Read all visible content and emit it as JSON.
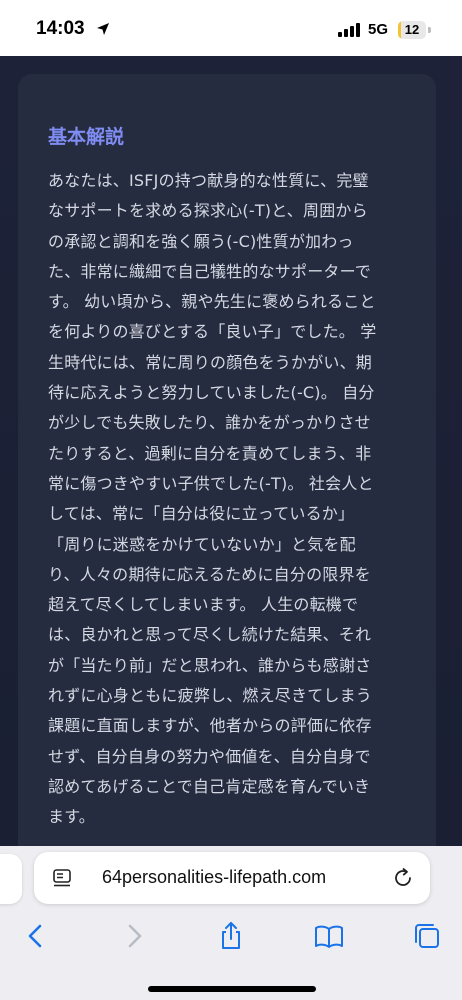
{
  "status_bar": {
    "time": "14:03",
    "network": "5G",
    "battery_level": "12",
    "battery_fraction": 0.12,
    "icons": [
      "location-arrow-icon",
      "cellular-signal-icon",
      "battery-icon"
    ]
  },
  "article": {
    "heading": "基本解説",
    "body": "あなたは、ISFJの持つ献身的な性質に、完璧\nなサポートを求める探求心(-T)と、周囲から\nの承認と調和を強く願う(-C)性質が加わっ\nた、非常に繊細で自己犠牲的なサポーターで\nす。 幼い頃から、親や先生に褒められること\nを何よりの喜びとする「良い子」でした。 学\n生時代には、常に周りの顔色をうかがい、期\n待に応えようと努力していました(-C)。 自分\nが少しでも失敗したり、誰かをがっかりさせ\nたりすると、過剰に自分を責めてしまう、非\n常に傷つきやすい子供でした(-T)。 社会人と\nしては、常に「自分は役に立っているか」\n「周りに迷惑をかけていないか」と気を配\nり、人々の期待に応えるために自分の限界を\n超えて尽くしてしまいます。 人生の転機で\nは、良かれと思って尽くし続けた結果、それ\nが「当たり前」だと思われ、誰からも感謝さ\nれずに心身ともに疲弊し、燃え尽きてしまう\n課題に直面しますが、他者からの評価に依存\nせず、自分自身の努力や価値を、自分自身で\n認めてあげることで自己肯定感を育んでいき\nます。"
  },
  "browser": {
    "url": "64personalities-lifepath.com",
    "icons": [
      "reader-mode-icon",
      "reload-icon",
      "back-icon",
      "forward-icon",
      "share-icon",
      "bookmarks-icon",
      "tabs-icon"
    ]
  },
  "colors": {
    "page_background": "#1d2238",
    "card_background": "#262c40",
    "heading_accent": "#7f8cf2",
    "body_text": "#d4d8e2",
    "ios_blue": "#1a73e8",
    "battery_yellow": "#f4c430"
  }
}
